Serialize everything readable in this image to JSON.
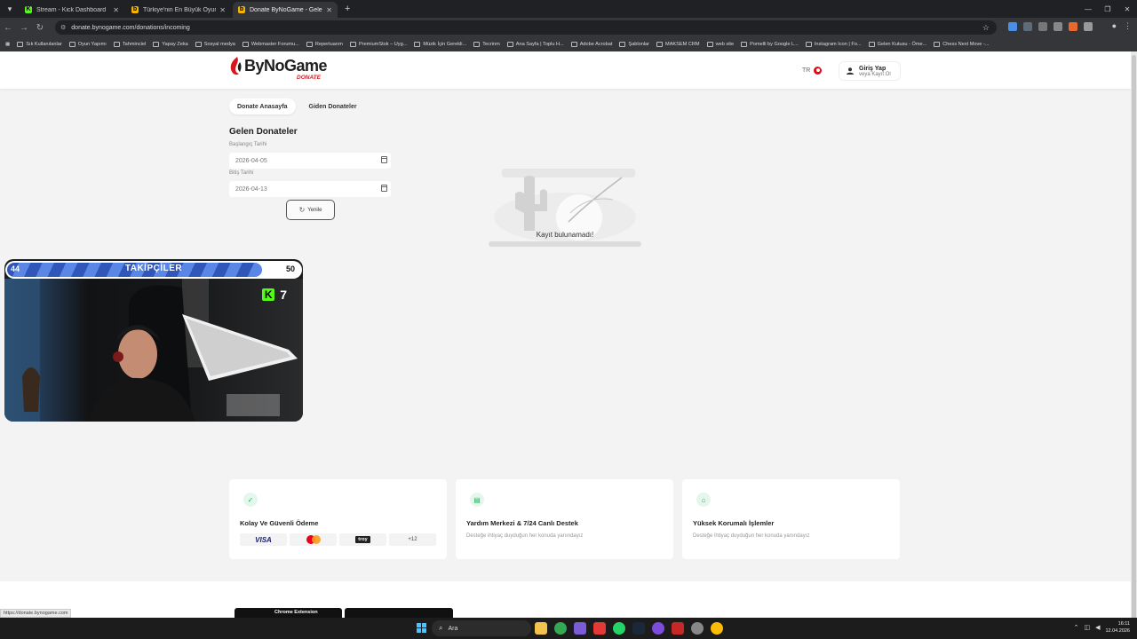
{
  "browser": {
    "tabs": [
      {
        "title": "Stream - Kick Dashboard",
        "favicon_color": "#53fc18",
        "favicon_letter": "K"
      },
      {
        "title": "Türkiye'nin En Büyük Oyuncu P",
        "favicon_color": "#f4b400",
        "favicon_letter": "b"
      },
      {
        "title": "Donate ByNoGame - Gelen/Gide",
        "favicon_color": "#f4b400",
        "favicon_letter": "b"
      }
    ],
    "url": "donate.bynogame.com/donations/incoming",
    "bookmarks": [
      "Sık Kullanılanlar",
      "Oyun Yapımı",
      "Tahminciel",
      "Yapay Zeka",
      "Sosyal medya",
      "Webmaster Forumu...",
      "Repertuarım",
      "PremiumStok – Uyg...",
      "Müzik İçin Gerekli...",
      "Tecrinm",
      "Ana Sayfa | Toplu H...",
      "Adobe Acrobat",
      "Şablonlar",
      "MAKSEM CRM",
      "web site",
      "Pomelli by Google L...",
      "Instagram Icon | Fo...",
      "Gelen Kutusu - Öme...",
      "Chess Next Move -..."
    ]
  },
  "site": {
    "logo_text": "ByNoGame",
    "logo_sub": "DONATE",
    "lang": "TR",
    "login_main": "Giriş Yap",
    "login_sub": "veya Kayıt Ol",
    "tabs": [
      "Donate Anasayfa",
      "Giden Donateler"
    ]
  },
  "main": {
    "title": "Gelen Donateler",
    "start_label": "Başlangıç Tarihi",
    "start_value": "2026-04-05",
    "end_label": "Bitiş Tarihi",
    "end_value": "2026-04-13",
    "refresh": "Yenile",
    "empty": "Kayıt bulunamadı!"
  },
  "overlay": {
    "label": "TAKİPÇİLER",
    "current": "44",
    "goal": "50",
    "progress": 0.87,
    "kick_count": "7"
  },
  "features": [
    {
      "title": "Kolay Ve Güvenli Ödeme",
      "desc": ""
    },
    {
      "title": "Yardım Merkezi & 7/24 Canlı Destek",
      "desc": "Desteğe ihtiyaç duyduğun her konuda yanındayız"
    },
    {
      "title": "Yüksek Korumalı İşlemler",
      "desc": "Desteğe ihtiyaç duyduğun her konuda yanındayız"
    }
  ],
  "payments": {
    "visa": "VISA",
    "troy": "troy",
    "more": "+12"
  },
  "footer": {
    "chrome_ext": "Chrome Extension"
  },
  "status_url": "https://donate.bynogame.com",
  "taskbar": {
    "search": "Ara",
    "time": "16:11",
    "date": "12.04.2026"
  },
  "colors": {
    "brand_red": "#d8161d",
    "kick_green": "#53fc18",
    "accent_green": "#23b35b"
  }
}
